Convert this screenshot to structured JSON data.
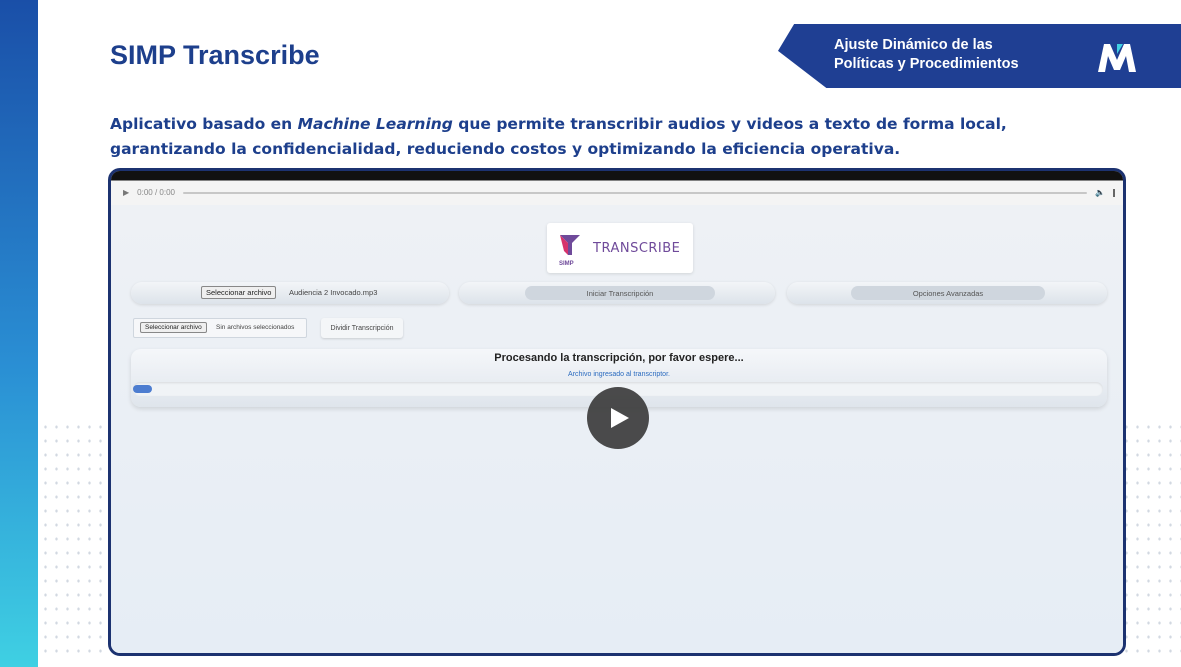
{
  "slide": {
    "title": "SIMP Transcribe",
    "badge_line1": "Ajuste Dinámico de las",
    "badge_line2": "Políticas y Procedimientos",
    "logo_icon": "m-brand-logo-icon",
    "desc_part1": "Aplicativo basado en ",
    "desc_em": "Machine Learning",
    "desc_part2": " que permite transcribir audios y videos a texto de forma local, garantizando la confidencialidad, reduciendo costos y optimizando la eficiencia operativa.",
    "colors": {
      "brand_blue": "#1d3f8c",
      "badge_bg": "#1f3f93",
      "accent_cyan": "#3fd0e3"
    }
  },
  "video": {
    "time": "0:00 / 0:00",
    "play_icon": "play-icon",
    "volume_icon": "volume-icon",
    "more_icon": "more-options-icon"
  },
  "app": {
    "logo_text": "TRANSCRIBE",
    "logo_small": "SIMP",
    "file_button": "Seleccionar archivo",
    "file_name": "Audiencia 2 Invocado.mp3",
    "start_button": "Iniciar Transcripción",
    "options_button": "Opciones Avanzadas",
    "file_button2": "Seleccionar archivo",
    "file_name2": "Sin archivos seleccionados",
    "split_button": "Dividir Transcripción",
    "processing_title": "Procesando la transcripción, por favor espere...",
    "processing_sub": "Archivo ingresado al transcriptor.",
    "progress": 0.02
  }
}
